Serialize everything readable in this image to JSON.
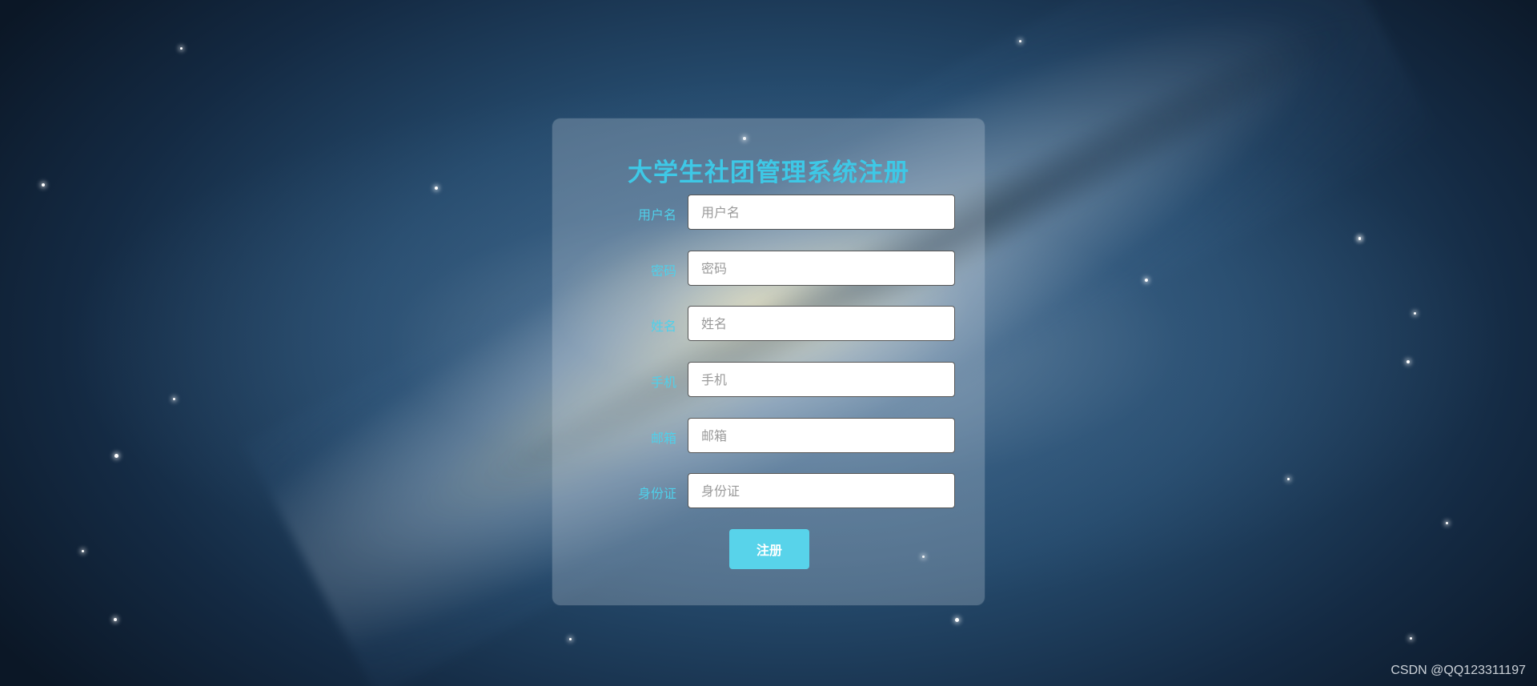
{
  "form": {
    "title": "大学生社团管理系统注册",
    "fields": [
      {
        "label": "用户名",
        "placeholder": "用户名"
      },
      {
        "label": "密码",
        "placeholder": "密码"
      },
      {
        "label": "姓名",
        "placeholder": "姓名"
      },
      {
        "label": "手机",
        "placeholder": "手机"
      },
      {
        "label": "邮箱",
        "placeholder": "邮箱"
      },
      {
        "label": "身份证",
        "placeholder": "身份证"
      }
    ],
    "submit_label": "注册"
  },
  "watermark": "CSDN @QQ123311197",
  "colors": {
    "accent": "#3ec8e6",
    "button": "#58d3ea",
    "background": "#254a6c"
  }
}
